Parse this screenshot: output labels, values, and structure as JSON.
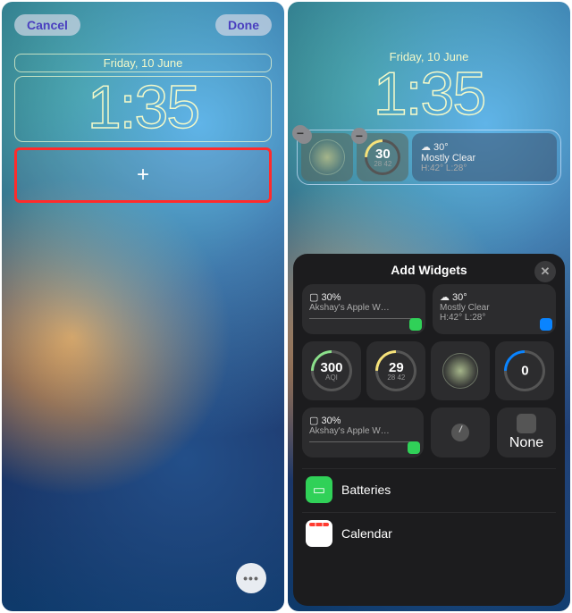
{
  "left": {
    "cancel": "Cancel",
    "done": "Done",
    "date": "Friday, 10 June",
    "time": "1:35",
    "add_glyph": "+",
    "more_glyph": "•••"
  },
  "right": {
    "date": "Friday, 10 June",
    "time": "1:35",
    "widgets": {
      "uv": {
        "value": "30",
        "range": "28  42"
      },
      "weather": {
        "temp": "☁︎  30°",
        "cond": "Mostly Clear",
        "hilo": "H:42° L:28°"
      }
    }
  },
  "panel": {
    "title": "Add Widgets",
    "cards": {
      "battery": {
        "icon": "▢ 30%",
        "label": "Akshay's Apple W…"
      },
      "weather_now": {
        "temp": "☁︎  30°",
        "cond": "Mostly Clear",
        "hilo": "H:42° L:28°"
      },
      "aqi": {
        "value": "300",
        "unit": "AQI"
      },
      "uv": {
        "value": "29",
        "range": "28  42"
      },
      "sun": {
        "value": "0"
      },
      "battery2": {
        "icon": "▢ 30%",
        "label": "Akshay's Apple W…"
      },
      "none": "None"
    },
    "categories": [
      {
        "name": "Batteries",
        "icon": "battery"
      },
      {
        "name": "Calendar",
        "icon": "calendar"
      }
    ]
  }
}
